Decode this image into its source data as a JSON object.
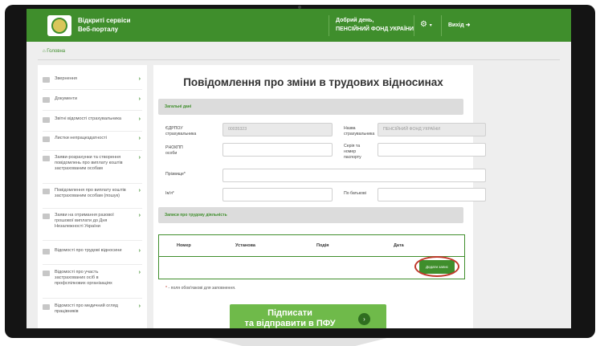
{
  "header": {
    "brand_line1": "Відкриті сервіси",
    "brand_line2": "Веб-порталу",
    "greeting_line1": "Добрий день,",
    "greeting_line2": "ПЕНСІЙНИЙ ФОНД УКРАЇНИ",
    "settings_caret": "▾",
    "exit_label": "Вихід"
  },
  "breadcrumb": {
    "home": "Головна"
  },
  "sidebar": {
    "items": [
      {
        "label": "Звернення",
        "icon": "envelope-icon"
      },
      {
        "label": "Документи",
        "icon": "document-icon"
      },
      {
        "label": "Звітні відомості страхувальника",
        "icon": "report-icon"
      },
      {
        "label": "Листки непрацездатності",
        "icon": "sheet-icon"
      },
      {
        "label": "Заяви-розрахунки та створення повідомлень про виплату коштів застрахованим особам",
        "icon": "calc-icon"
      },
      {
        "label": "Повідомлення про виплату коштів застрахованим особам (пошук)",
        "icon": "search-doc-icon"
      },
      {
        "label": "Заяви на отримання разової грошової виплати до Дня Незалежності України",
        "icon": "form-icon"
      },
      {
        "label": "Відомості про трудові відносини",
        "icon": "card-icon"
      },
      {
        "label": "Відомості про участь застрахованих осіб в профспілкових організаціях",
        "icon": "group-icon"
      },
      {
        "label": "Відомості про медичний огляд працівників",
        "icon": "medical-icon"
      }
    ]
  },
  "main": {
    "title": "Повідомлення про зміни в трудових відносинах",
    "section_general": "Загальні дані",
    "edrpou_label_1": "ЄДРПОУ",
    "edrpou_label_2": "страхувальника",
    "edrpou_value": "00035323",
    "name_label_1": "Назва",
    "name_label_2": "страхувальника",
    "name_value": "ПЕНСІЙНИЙ ФОНД УКРАЇНИ",
    "rnokpp_label_1": "РНОКПП",
    "rnokpp_label_2": "особи",
    "passport_label_1": "Серія та",
    "passport_label_2": "номер",
    "passport_label_3": "паспорту",
    "surname_label": "Прізвище*",
    "firstname_label": "Ім'я*",
    "patronymic_label": "По батькові",
    "section_records": "Записи про трудову діяльність",
    "table_headers": [
      "Номер",
      "Установа",
      "Подія",
      "Дата"
    ],
    "add_record": "Додати запис",
    "required_star": "*",
    "required_note": " - поля обов'язкові для заповнення.",
    "sign_line1": "Підписати",
    "sign_line2": "та відправити в ПФУ"
  }
}
